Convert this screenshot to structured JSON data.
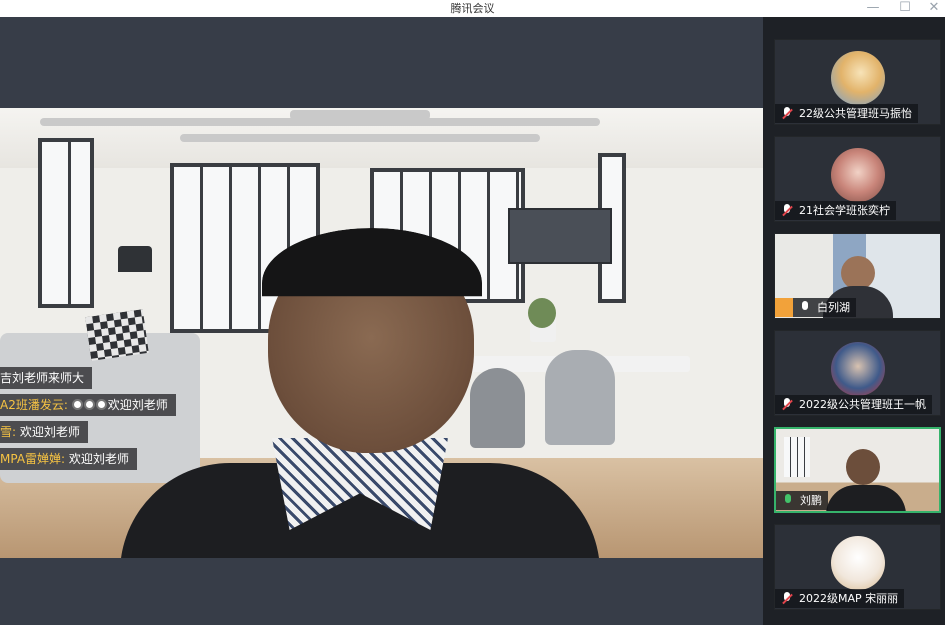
{
  "window": {
    "title": "腾讯会议",
    "minimize": "—",
    "maximize": "☐",
    "close": "✕"
  },
  "chat": [
    {
      "name": "",
      "text": "吉刘老师来师大"
    },
    {
      "name": "A2班潘发云: ",
      "text": "欢迎刘老师",
      "emoji_count": 3
    },
    {
      "name": "雪: ",
      "text": "欢迎刘老师"
    },
    {
      "name": "MPA雷婵婵: ",
      "text": "欢迎刘老师"
    }
  ],
  "participants": [
    {
      "name": "22级公共管理班马振怡",
      "mic": "muted",
      "type": "avatar",
      "avatar_color": "#e2b36a"
    },
    {
      "name": "21社会学班张奕柠",
      "mic": "muted",
      "type": "avatar",
      "avatar_color": "#c9857a"
    },
    {
      "name": "白列湖",
      "mic": "on",
      "type": "video",
      "host": true
    },
    {
      "name": "2022级公共管理班王一帆",
      "mic": "muted",
      "type": "avatar",
      "avatar_color": "#3f5a8a"
    },
    {
      "name": "刘鹏",
      "mic": "on",
      "type": "video",
      "active": true
    },
    {
      "name": "2022级MAP 宋丽丽",
      "mic": "muted",
      "type": "avatar",
      "avatar_color": "#e9d9c4"
    }
  ],
  "colors": {
    "active_border": "#36b36b",
    "mic_muted": "#e2454c",
    "mic_on": "#43c36a",
    "chat_name": "#f6c343"
  }
}
